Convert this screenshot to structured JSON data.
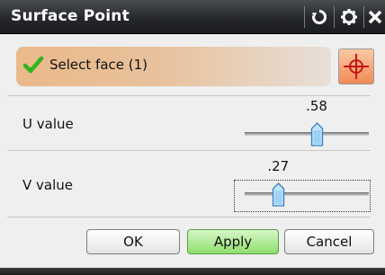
{
  "window": {
    "title": "Surface Point",
    "buttons": [
      {
        "name": "reset",
        "icon": "reset-icon"
      },
      {
        "name": "settings",
        "icon": "gear-icon"
      },
      {
        "name": "close",
        "icon": "close-icon"
      }
    ]
  },
  "selection": {
    "label": "Select face (1)",
    "status_icon": "check-icon",
    "button_icon": "crosshair-icon"
  },
  "u": {
    "label": "U value",
    "value_text": ".58",
    "value": 0.58
  },
  "v": {
    "label": "V value",
    "value_text": ".27",
    "value": 0.27
  },
  "footer": {
    "ok_label": "OK",
    "apply_label": "Apply",
    "cancel_label": "Cancel"
  },
  "colors": {
    "title_bar": "#26282b",
    "selection_fill": "#eab98a",
    "check_green": "#2fb51f",
    "accent_button": "#f08a55",
    "apply_green": "#8ee06d"
  }
}
